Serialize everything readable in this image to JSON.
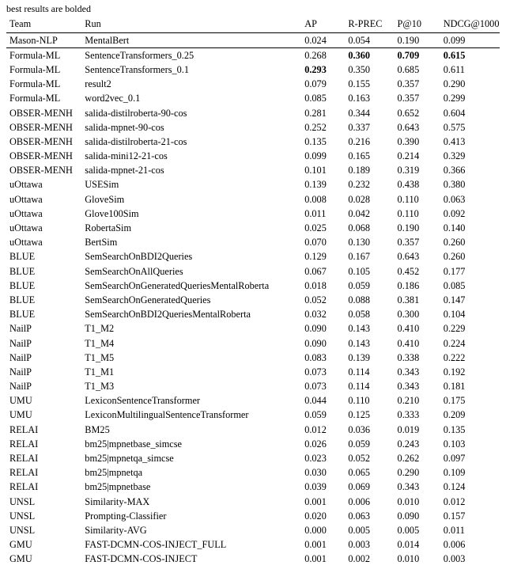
{
  "caption": "best results are bolded",
  "columns": [
    "Team",
    "Run",
    "AP",
    "R-PREC",
    "P@10",
    "NDCG@1000"
  ],
  "bold": {
    "row1": {
      "R-PREC": true,
      "P@10": true,
      "NDCG@1000": true
    },
    "row2": {
      "AP": true
    }
  },
  "chart_data": {
    "type": "table",
    "rows": [
      {
        "section_end": true,
        "team": "Mason-NLP",
        "run": "MentalBert",
        "AP": "0.024",
        "R-PREC": "0.054",
        "P@10": "0.190",
        "NDCG@1000": "0.099"
      },
      {
        "team": "Formula-ML",
        "run": "SentenceTransformers_0.25",
        "AP": "0.268",
        "R-PREC": "0.360",
        "P@10": "0.709",
        "NDCG@1000": "0.615",
        "bold": {
          "R-PREC": true,
          "P@10": true,
          "NDCG@1000": true
        }
      },
      {
        "team": "Formula-ML",
        "run": "SentenceTransformers_0.1",
        "AP": "0.293",
        "R-PREC": "0.350",
        "P@10": "0.685",
        "NDCG@1000": "0.611",
        "bold": {
          "AP": true
        }
      },
      {
        "team": "Formula-ML",
        "run": "result2",
        "AP": "0.079",
        "R-PREC": "0.155",
        "P@10": "0.357",
        "NDCG@1000": "0.290"
      },
      {
        "team": "Formula-ML",
        "run": "word2vec_0.1",
        "AP": "0.085",
        "R-PREC": "0.163",
        "P@10": "0.357",
        "NDCG@1000": "0.299"
      },
      {
        "team": "OBSER-MENH",
        "run": "salida-distilroberta-90-cos",
        "AP": "0.281",
        "R-PREC": "0.344",
        "P@10": "0.652",
        "NDCG@1000": "0.604"
      },
      {
        "team": "OBSER-MENH",
        "run": "salida-mpnet-90-cos",
        "AP": "0.252",
        "R-PREC": "0.337",
        "P@10": "0.643",
        "NDCG@1000": "0.575"
      },
      {
        "team": "OBSER-MENH",
        "run": "salida-distilroberta-21-cos",
        "AP": "0.135",
        "R-PREC": "0.216",
        "P@10": "0.390",
        "NDCG@1000": "0.413"
      },
      {
        "team": "OBSER-MENH",
        "run": "salida-mini12-21-cos",
        "AP": "0.099",
        "R-PREC": "0.165",
        "P@10": "0.214",
        "NDCG@1000": "0.329"
      },
      {
        "team": "OBSER-MENH",
        "run": "salida-mpnet-21-cos",
        "AP": "0.101",
        "R-PREC": "0.189",
        "P@10": "0.319",
        "NDCG@1000": "0.366"
      },
      {
        "team": "uOttawa",
        "run": "USESim",
        "AP": "0.139",
        "R-PREC": "0.232",
        "P@10": "0.438",
        "NDCG@1000": "0.380"
      },
      {
        "team": "uOttawa",
        "run": "GloveSim",
        "AP": "0.008",
        "R-PREC": "0.028",
        "P@10": "0.110",
        "NDCG@1000": "0.063"
      },
      {
        "team": "uOttawa",
        "run": "Glove100Sim",
        "AP": "0.011",
        "R-PREC": "0.042",
        "P@10": "0.110",
        "NDCG@1000": "0.092"
      },
      {
        "team": "uOttawa",
        "run": "RobertaSim",
        "AP": "0.025",
        "R-PREC": "0.068",
        "P@10": "0.190",
        "NDCG@1000": "0.140"
      },
      {
        "team": "uOttawa",
        "run": "BertSim",
        "AP": "0.070",
        "R-PREC": "0.130",
        "P@10": "0.357",
        "NDCG@1000": "0.260"
      },
      {
        "team": "BLUE",
        "run": "SemSearchOnBDI2Queries",
        "AP": "0.129",
        "R-PREC": "0.167",
        "P@10": "0.643",
        "NDCG@1000": "0.260"
      },
      {
        "team": "BLUE",
        "run": "SemSearchOnAllQueries",
        "AP": "0.067",
        "R-PREC": "0.105",
        "P@10": "0.452",
        "NDCG@1000": "0.177"
      },
      {
        "team": "BLUE",
        "run": "SemSearchOnGeneratedQueriesMentalRoberta",
        "AP": "0.018",
        "R-PREC": "0.059",
        "P@10": "0.186",
        "NDCG@1000": "0.085"
      },
      {
        "team": "BLUE",
        "run": "SemSearchOnGeneratedQueries",
        "AP": "0.052",
        "R-PREC": "0.088",
        "P@10": "0.381",
        "NDCG@1000": "0.147"
      },
      {
        "team": "BLUE",
        "run": "SemSearchOnBDI2QueriesMentalRoberta",
        "AP": "0.032",
        "R-PREC": "0.058",
        "P@10": "0.300",
        "NDCG@1000": "0.104"
      },
      {
        "team": "NailP",
        "run": "T1_M2",
        "AP": "0.090",
        "R-PREC": "0.143",
        "P@10": "0.410",
        "NDCG@1000": "0.229"
      },
      {
        "team": "NailP",
        "run": "T1_M4",
        "AP": "0.090",
        "R-PREC": "0.143",
        "P@10": "0.410",
        "NDCG@1000": "0.224"
      },
      {
        "team": "NailP",
        "run": "T1_M5",
        "AP": "0.083",
        "R-PREC": "0.139",
        "P@10": "0.338",
        "NDCG@1000": "0.222"
      },
      {
        "team": "NailP",
        "run": "T1_M1",
        "AP": "0.073",
        "R-PREC": "0.114",
        "P@10": "0.343",
        "NDCG@1000": "0.192"
      },
      {
        "team": "NailP",
        "run": "T1_M3",
        "AP": "0.073",
        "R-PREC": "0.114",
        "P@10": "0.343",
        "NDCG@1000": "0.181"
      },
      {
        "team": "UMU",
        "run": "LexiconSentenceTransformer",
        "AP": "0.044",
        "R-PREC": "0.110",
        "P@10": "0.210",
        "NDCG@1000": "0.175"
      },
      {
        "team": "UMU",
        "run": "LexiconMultilingualSentenceTransformer",
        "AP": "0.059",
        "R-PREC": "0.125",
        "P@10": "0.333",
        "NDCG@1000": "0.209"
      },
      {
        "team": "RELAI",
        "run": "BM25",
        "AP": "0.012",
        "R-PREC": "0.036",
        "P@10": "0.019",
        "NDCG@1000": "0.135"
      },
      {
        "team": "RELAI",
        "run": "bm25|mpnetbase_simcse",
        "AP": "0.026",
        "R-PREC": "0.059",
        "P@10": "0.243",
        "NDCG@1000": "0.103"
      },
      {
        "team": "RELAI",
        "run": "bm25|mpnetqa_simcse",
        "AP": "0.023",
        "R-PREC": "0.052",
        "P@10": "0.262",
        "NDCG@1000": "0.097"
      },
      {
        "team": "RELAI",
        "run": "bm25|mpnetqa",
        "AP": "0.030",
        "R-PREC": "0.065",
        "P@10": "0.290",
        "NDCG@1000": "0.109"
      },
      {
        "team": "RELAI",
        "run": "bm25|mpnetbase",
        "AP": "0.039",
        "R-PREC": "0.069",
        "P@10": "0.343",
        "NDCG@1000": "0.124"
      },
      {
        "team": "UNSL",
        "run": "Similarity-MAX",
        "AP": "0.001",
        "R-PREC": "0.006",
        "P@10": "0.010",
        "NDCG@1000": "0.012"
      },
      {
        "team": "UNSL",
        "run": "Prompting-Classifier",
        "AP": "0.020",
        "R-PREC": "0.063",
        "P@10": "0.090",
        "NDCG@1000": "0.157"
      },
      {
        "team": "UNSL",
        "run": "Similarity-AVG",
        "AP": "0.000",
        "R-PREC": "0.005",
        "P@10": "0.005",
        "NDCG@1000": "0.011"
      },
      {
        "team": "GMU",
        "run": "FAST-DCMN-COS-INJECT_FULL",
        "AP": "0.001",
        "R-PREC": "0.003",
        "P@10": "0.014",
        "NDCG@1000": "0.006"
      },
      {
        "team": "GMU",
        "run": "FAST-DCMN-COS-INJECT",
        "AP": "0.001",
        "R-PREC": "0.002",
        "P@10": "0.010",
        "NDCG@1000": "0.003"
      }
    ]
  }
}
